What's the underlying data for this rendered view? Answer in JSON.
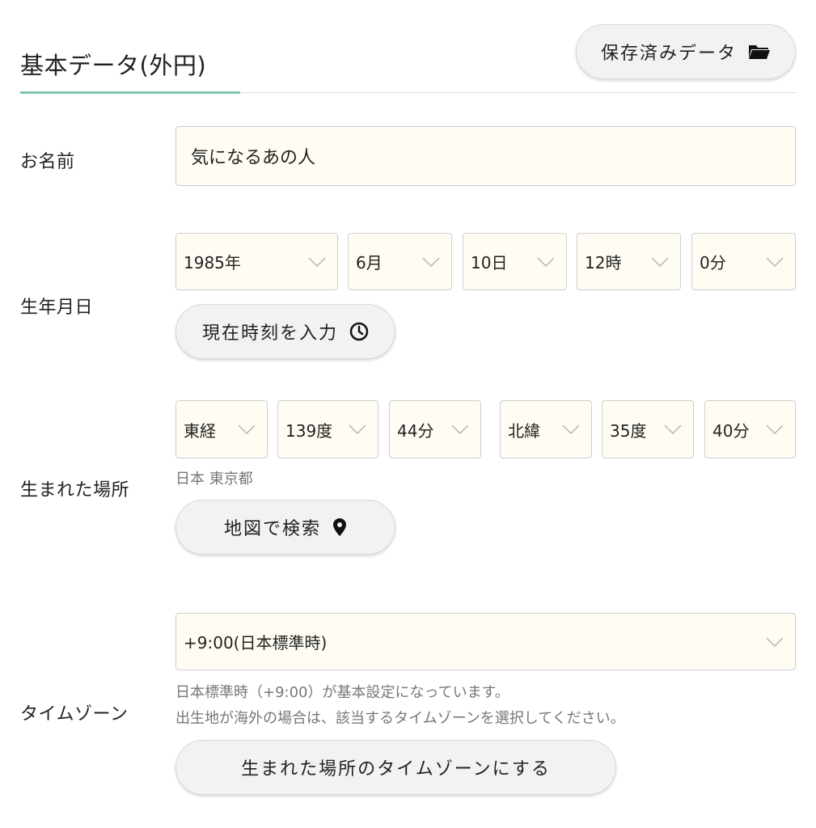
{
  "header": {
    "title": "基本データ(外円)",
    "saved_data_button": "保存済みデータ",
    "accent_color": "#7cc4b4"
  },
  "name_section": {
    "label": "お名前",
    "value": "気になるあの人"
  },
  "birth_section": {
    "label": "生年月日",
    "year": "1985年",
    "month": "6月",
    "day": "10日",
    "hour": "12時",
    "minute": "0分",
    "now_button": "現在時刻を入力"
  },
  "place_section": {
    "label": "生まれた場所",
    "longitude_dir": "東経",
    "longitude_deg": "139度",
    "longitude_min": "44分",
    "latitude_dir": "北緯",
    "latitude_deg": "35度",
    "latitude_min": "40分",
    "place_name": "日本 東京都",
    "map_button": "地図で検索"
  },
  "timezone_section": {
    "label": "タイムゾーン",
    "selected": "+9:00(日本標準時)",
    "note_line1": "日本標準時（+9:00）が基本設定になっています。",
    "note_line2": "出生地が海外の場合は、該当するタイムゾーンを選択してください。",
    "birthplace_tz_button": "生まれた場所のタイムゾーンにする"
  },
  "icons": {
    "folder": "folder-open-icon",
    "clock": "clock-icon",
    "pin": "map-pin-icon",
    "chevron": "chevron-down-icon"
  }
}
